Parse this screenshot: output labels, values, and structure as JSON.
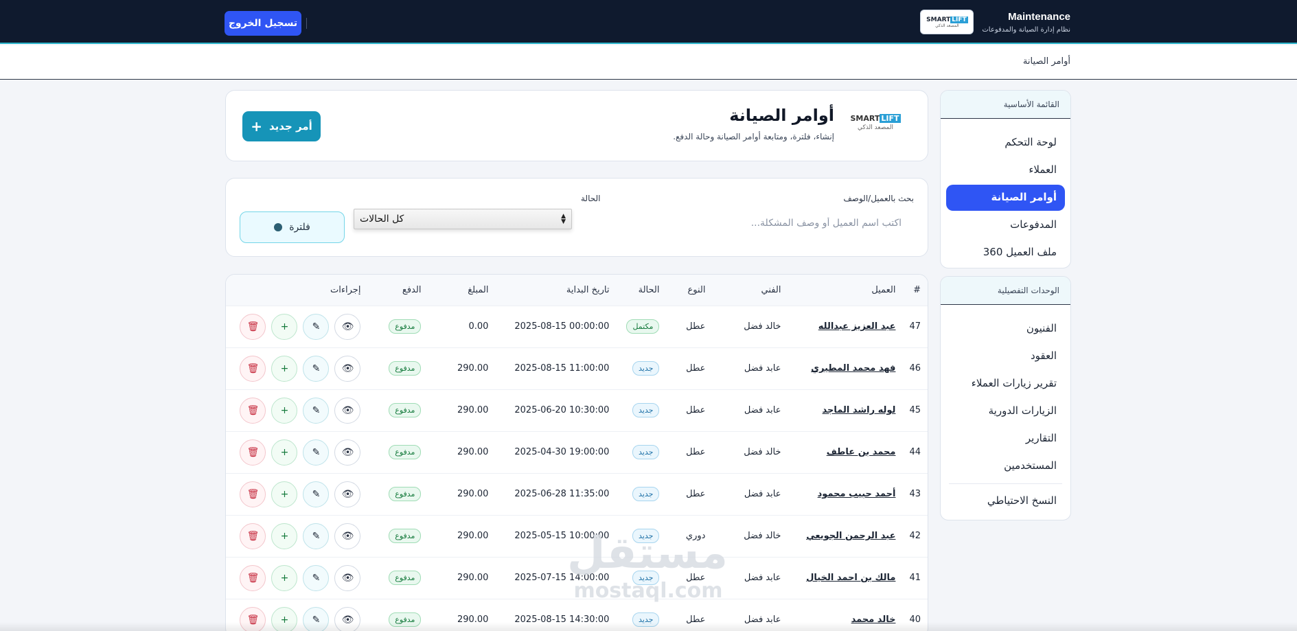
{
  "topbar": {
    "brand_title": "Maintenance",
    "brand_subtitle": "نظام إدارة الصيانة والمدفوعات",
    "logo_left": "SMART",
    "logo_right": "LIFT",
    "logo_sub": "المصعد الذكي",
    "logout_label": "تسجيل الخروج"
  },
  "breadcrumb": "أوامر الصيانة",
  "sidebar": {
    "main_title": "القائمة الأساسية",
    "main_items": [
      {
        "label": "لوحة التحكم"
      },
      {
        "label": "العملاء"
      },
      {
        "label": "أوامر الصيانة",
        "active": true
      },
      {
        "label": "المدفوعات"
      },
      {
        "label": "ملف العميل 360"
      }
    ],
    "detail_title": "الوحدات التفصيلية",
    "detail_items": [
      {
        "label": "الفنيون"
      },
      {
        "label": "العقود"
      },
      {
        "label": "تقرير زيارات العملاء"
      },
      {
        "label": "الزيارات الدورية"
      },
      {
        "label": "التقارير"
      },
      {
        "label": "المستخدمين"
      },
      {
        "label": "النسخ الاحتياطي"
      }
    ]
  },
  "header": {
    "logo_left": "SMART",
    "logo_right": "LIFT",
    "logo_sub": "المصعد الذكي",
    "title": "أوامر الصيانة",
    "subtitle": "إنشاء، فلترة، ومتابعة أوامر الصيانة وحالة الدفع.",
    "new_button": "أمر جديد"
  },
  "filters": {
    "search_label": "بحث بالعميل/الوصف",
    "search_placeholder": "اكتب اسم العميل أو وصف المشكلة...",
    "search_value": "",
    "status_label": "الحالة",
    "status_value": "كل الحالات",
    "filter_button": "فلترة"
  },
  "table": {
    "columns": [
      "#",
      "العميل",
      "الفني",
      "النوع",
      "الحالة",
      "تاريخ البداية",
      "المبلغ",
      "الدفع",
      "إجراءات"
    ],
    "rows": [
      {
        "id": "47",
        "client": "عبد العزيز عبدالله",
        "tech": "خالد فضل",
        "type": "عطل",
        "status": "مكتمل",
        "status_kind": "done",
        "date": "2025-08-15 00:00:00",
        "amount": "0.00",
        "payment": "مدفوع"
      },
      {
        "id": "46",
        "client": "فهد محمد المطيري",
        "tech": "عابد فضل",
        "type": "عطل",
        "status": "جديد",
        "status_kind": "new",
        "date": "2025-08-15 11:00:00",
        "amount": "290.00",
        "payment": "مدفوع"
      },
      {
        "id": "45",
        "client": "لوله راشد الماجد",
        "tech": "عابد فضل",
        "type": "عطل",
        "status": "جديد",
        "status_kind": "new",
        "date": "2025-06-20 10:30:00",
        "amount": "290.00",
        "payment": "مدفوع"
      },
      {
        "id": "44",
        "client": "محمد بن عاطف",
        "tech": "خالد فضل",
        "type": "عطل",
        "status": "جديد",
        "status_kind": "new",
        "date": "2025-04-30 19:00:00",
        "amount": "290.00",
        "payment": "مدفوع"
      },
      {
        "id": "43",
        "client": "أحمد حبيب محمود",
        "tech": "عابد فضل",
        "type": "عطل",
        "status": "جديد",
        "status_kind": "new",
        "date": "2025-06-28 11:35:00",
        "amount": "290.00",
        "payment": "مدفوع"
      },
      {
        "id": "42",
        "client": "عبد الرحمن الجويعي",
        "tech": "خالد فضل",
        "type": "دوري",
        "status": "جديد",
        "status_kind": "new",
        "date": "2025-05-15 10:00:00",
        "amount": "290.00",
        "payment": "مدفوع"
      },
      {
        "id": "41",
        "client": "مالك بن احمد الخيال",
        "tech": "عابد فضل",
        "type": "عطل",
        "status": "جديد",
        "status_kind": "new",
        "date": "2025-07-15 14:00:00",
        "amount": "290.00",
        "payment": "مدفوع"
      },
      {
        "id": "40",
        "client": "خالد محمد",
        "tech": "عابد فضل",
        "type": "عطل",
        "status": "جديد",
        "status_kind": "new",
        "date": "2025-08-15 14:30:00",
        "amount": "290.00",
        "payment": "مدفوع"
      }
    ]
  },
  "watermark": {
    "big": "مستقل",
    "small": "mostaql.com"
  },
  "colors": {
    "topbar": "#0f1a2e",
    "accent": "#2f55f4",
    "primary_teal": "#1694b8"
  }
}
